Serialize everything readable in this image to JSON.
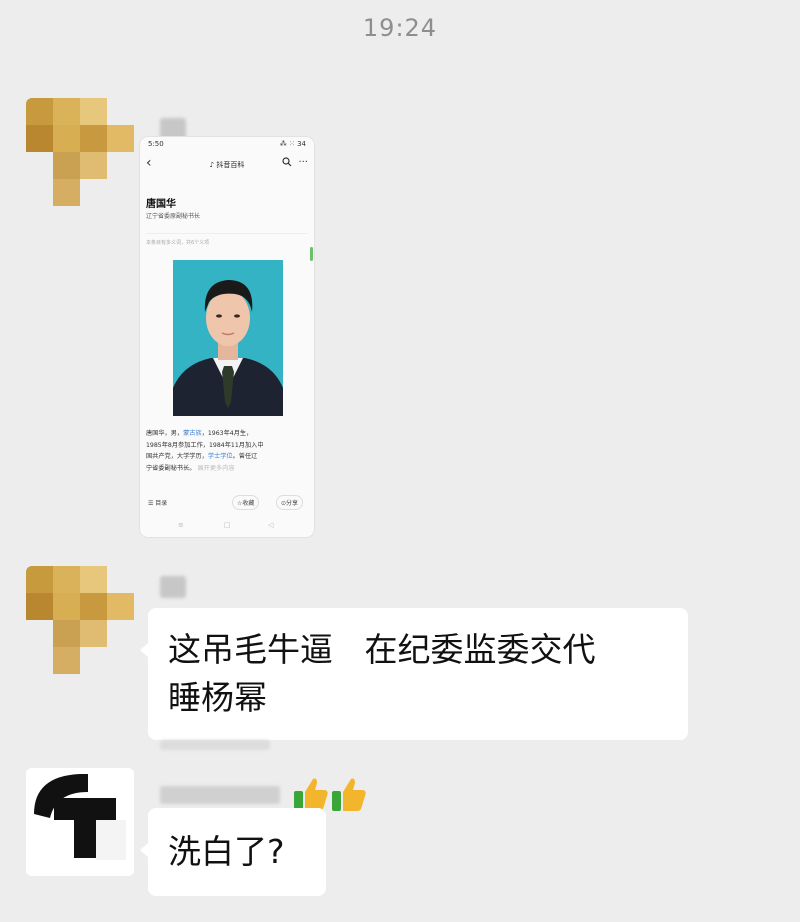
{
  "chat": {
    "timestamp": "19:24",
    "messages": [
      {
        "type": "image",
        "shared_page": {
          "status_time": "5:50",
          "status_icons": "⁂ ⁙ 34",
          "back_icon": "chevron-left-icon",
          "brand": "抖音百科",
          "person_name": "唐国华",
          "person_title": "辽宁省委原副秘书长",
          "hint": "本条目有多义词，共6个义项",
          "bio_parts": [
            "唐国华，男，",
            "蒙古族",
            "，1963年4月生，",
            "1985年8月参加工作，1984年11月加入中",
            "国共产党，大学学历，",
            "学士学位",
            "。曾任辽",
            "宁省委副秘书长。",
            "展开更多内容"
          ],
          "bottom": {
            "toc": "目录",
            "favorite": "收藏",
            "share": "分享"
          },
          "home_bar": [
            "≡",
            "□",
            "◁"
          ]
        }
      },
      {
        "type": "text",
        "lines": [
          "这吊毛牛逼   在纪委监委交代",
          "睡杨幂"
        ],
        "emoji": [
          "thumbs-up",
          "thumbs-up"
        ]
      },
      {
        "type": "text",
        "lines": [
          "洗白了?"
        ]
      }
    ]
  }
}
